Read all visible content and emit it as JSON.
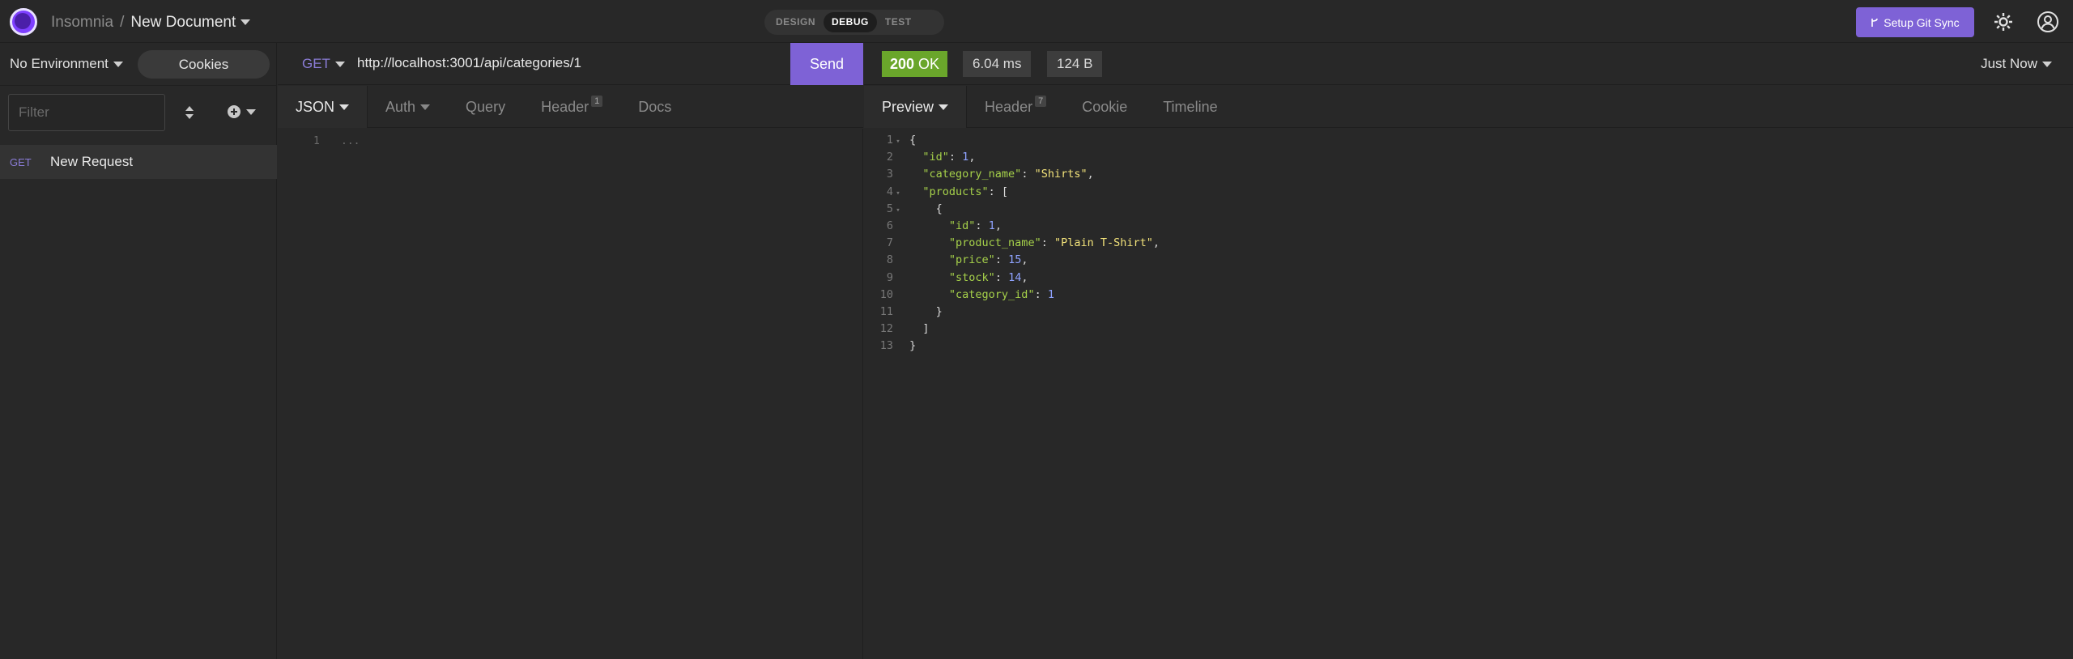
{
  "topbar": {
    "app_name": "Insomnia",
    "separator": "/",
    "document_name": "New Document",
    "modes": [
      "DESIGN",
      "DEBUG",
      "TEST"
    ],
    "active_mode": "DEBUG",
    "git_sync_label": "Setup Git Sync",
    "accent_color": "#7e62d6"
  },
  "sidebar": {
    "environment": "No Environment",
    "cookies_label": "Cookies",
    "filter_placeholder": "Filter",
    "requests": [
      {
        "method": "GET",
        "name": "New Request"
      }
    ]
  },
  "request": {
    "method": "GET",
    "url": "http://localhost:3001/api/categories/1",
    "send_label": "Send",
    "tabs": [
      {
        "label": "JSON",
        "active": true
      },
      {
        "label": "Auth"
      },
      {
        "label": "Query"
      },
      {
        "label": "Header",
        "badge": "1"
      },
      {
        "label": "Docs"
      }
    ],
    "body_line_number": "1",
    "body_placeholder": "..."
  },
  "response": {
    "status_code": "200",
    "status_text": "OK",
    "status_color": "#6aa62b",
    "time": "6.04 ms",
    "size": "124 B",
    "history_label": "Just Now",
    "tabs": [
      {
        "label": "Preview",
        "active": true
      },
      {
        "label": "Header",
        "badge": "7"
      },
      {
        "label": "Cookie"
      },
      {
        "label": "Timeline"
      }
    ],
    "lines": [
      "{",
      "  \"id\": 1,",
      "  \"category_name\": \"Shirts\",",
      "  \"products\": [",
      "    {",
      "      \"id\": 1,",
      "      \"product_name\": \"Plain T-Shirt\",",
      "      \"price\": 15,",
      "      \"stock\": 14,",
      "      \"category_id\": 1",
      "    }",
      "  ]",
      "}"
    ]
  }
}
